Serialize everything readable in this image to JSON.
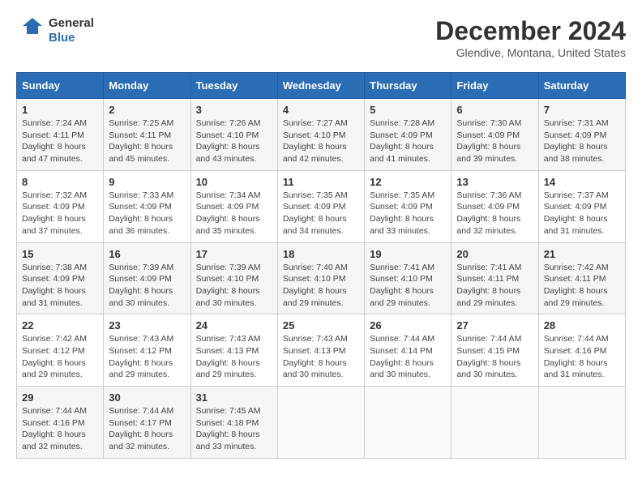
{
  "logo": {
    "line1": "General",
    "line2": "Blue"
  },
  "title": "December 2024",
  "subtitle": "Glendive, Montana, United States",
  "headers": [
    "Sunday",
    "Monday",
    "Tuesday",
    "Wednesday",
    "Thursday",
    "Friday",
    "Saturday"
  ],
  "weeks": [
    [
      {
        "day": "1",
        "sunrise": "7:24 AM",
        "sunset": "4:11 PM",
        "daylight": "8 hours and 47 minutes."
      },
      {
        "day": "2",
        "sunrise": "7:25 AM",
        "sunset": "4:11 PM",
        "daylight": "8 hours and 45 minutes."
      },
      {
        "day": "3",
        "sunrise": "7:26 AM",
        "sunset": "4:10 PM",
        "daylight": "8 hours and 43 minutes."
      },
      {
        "day": "4",
        "sunrise": "7:27 AM",
        "sunset": "4:10 PM",
        "daylight": "8 hours and 42 minutes."
      },
      {
        "day": "5",
        "sunrise": "7:28 AM",
        "sunset": "4:09 PM",
        "daylight": "8 hours and 41 minutes."
      },
      {
        "day": "6",
        "sunrise": "7:30 AM",
        "sunset": "4:09 PM",
        "daylight": "8 hours and 39 minutes."
      },
      {
        "day": "7",
        "sunrise": "7:31 AM",
        "sunset": "4:09 PM",
        "daylight": "8 hours and 38 minutes."
      }
    ],
    [
      {
        "day": "8",
        "sunrise": "7:32 AM",
        "sunset": "4:09 PM",
        "daylight": "8 hours and 37 minutes."
      },
      {
        "day": "9",
        "sunrise": "7:33 AM",
        "sunset": "4:09 PM",
        "daylight": "8 hours and 36 minutes."
      },
      {
        "day": "10",
        "sunrise": "7:34 AM",
        "sunset": "4:09 PM",
        "daylight": "8 hours and 35 minutes."
      },
      {
        "day": "11",
        "sunrise": "7:35 AM",
        "sunset": "4:09 PM",
        "daylight": "8 hours and 34 minutes."
      },
      {
        "day": "12",
        "sunrise": "7:35 AM",
        "sunset": "4:09 PM",
        "daylight": "8 hours and 33 minutes."
      },
      {
        "day": "13",
        "sunrise": "7:36 AM",
        "sunset": "4:09 PM",
        "daylight": "8 hours and 32 minutes."
      },
      {
        "day": "14",
        "sunrise": "7:37 AM",
        "sunset": "4:09 PM",
        "daylight": "8 hours and 31 minutes."
      }
    ],
    [
      {
        "day": "15",
        "sunrise": "7:38 AM",
        "sunset": "4:09 PM",
        "daylight": "8 hours and 31 minutes."
      },
      {
        "day": "16",
        "sunrise": "7:39 AM",
        "sunset": "4:09 PM",
        "daylight": "8 hours and 30 minutes."
      },
      {
        "day": "17",
        "sunrise": "7:39 AM",
        "sunset": "4:10 PM",
        "daylight": "8 hours and 30 minutes."
      },
      {
        "day": "18",
        "sunrise": "7:40 AM",
        "sunset": "4:10 PM",
        "daylight": "8 hours and 29 minutes."
      },
      {
        "day": "19",
        "sunrise": "7:41 AM",
        "sunset": "4:10 PM",
        "daylight": "8 hours and 29 minutes."
      },
      {
        "day": "20",
        "sunrise": "7:41 AM",
        "sunset": "4:11 PM",
        "daylight": "8 hours and 29 minutes."
      },
      {
        "day": "21",
        "sunrise": "7:42 AM",
        "sunset": "4:11 PM",
        "daylight": "8 hours and 29 minutes."
      }
    ],
    [
      {
        "day": "22",
        "sunrise": "7:42 AM",
        "sunset": "4:12 PM",
        "daylight": "8 hours and 29 minutes."
      },
      {
        "day": "23",
        "sunrise": "7:43 AM",
        "sunset": "4:12 PM",
        "daylight": "8 hours and 29 minutes."
      },
      {
        "day": "24",
        "sunrise": "7:43 AM",
        "sunset": "4:13 PM",
        "daylight": "8 hours and 29 minutes."
      },
      {
        "day": "25",
        "sunrise": "7:43 AM",
        "sunset": "4:13 PM",
        "daylight": "8 hours and 30 minutes."
      },
      {
        "day": "26",
        "sunrise": "7:44 AM",
        "sunset": "4:14 PM",
        "daylight": "8 hours and 30 minutes."
      },
      {
        "day": "27",
        "sunrise": "7:44 AM",
        "sunset": "4:15 PM",
        "daylight": "8 hours and 30 minutes."
      },
      {
        "day": "28",
        "sunrise": "7:44 AM",
        "sunset": "4:16 PM",
        "daylight": "8 hours and 31 minutes."
      }
    ],
    [
      {
        "day": "29",
        "sunrise": "7:44 AM",
        "sunset": "4:16 PM",
        "daylight": "8 hours and 32 minutes."
      },
      {
        "day": "30",
        "sunrise": "7:44 AM",
        "sunset": "4:17 PM",
        "daylight": "8 hours and 32 minutes."
      },
      {
        "day": "31",
        "sunrise": "7:45 AM",
        "sunset": "4:18 PM",
        "daylight": "8 hours and 33 minutes."
      },
      null,
      null,
      null,
      null
    ]
  ]
}
